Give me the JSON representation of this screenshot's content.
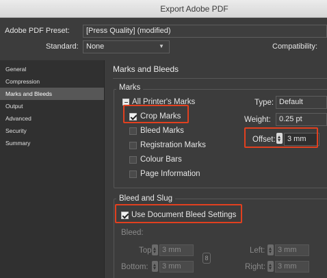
{
  "window": {
    "title": "Export Adobe PDF"
  },
  "top": {
    "preset_label": "Adobe PDF Preset:",
    "preset_value": "[Press Quality] (modified)",
    "standard_label": "Standard:",
    "standard_value": "None",
    "compat_label": "Compatibility:"
  },
  "sidebar": {
    "items": [
      {
        "label": "General"
      },
      {
        "label": "Compression"
      },
      {
        "label": "Marks and Bleeds"
      },
      {
        "label": "Output"
      },
      {
        "label": "Advanced"
      },
      {
        "label": "Security"
      },
      {
        "label": "Summary"
      }
    ]
  },
  "panel": {
    "title": "Marks and Bleeds",
    "marks": {
      "legend": "Marks",
      "all_printers": "All Printer's Marks",
      "crop": "Crop Marks",
      "bleed": "Bleed Marks",
      "registration": "Registration Marks",
      "colour_bars": "Colour Bars",
      "page_info": "Page Information",
      "type_label": "Type:",
      "type_value": "Default",
      "weight_label": "Weight:",
      "weight_value": "0.25 pt",
      "offset_label": "Offset:",
      "offset_value": "3 mm"
    },
    "bleed": {
      "legend": "Bleed and Slug",
      "use_doc": "Use Document Bleed Settings",
      "bleed_label": "Bleed:",
      "top_label": "Top:",
      "top_value": "3 mm",
      "bottom_label": "Bottom:",
      "bottom_value": "3 mm",
      "left_label": "Left:",
      "left_value": "3 mm",
      "right_label": "Right:",
      "right_value": "3 mm"
    }
  },
  "colors": {
    "highlight": "#e2401f",
    "active_item": "#575757"
  }
}
